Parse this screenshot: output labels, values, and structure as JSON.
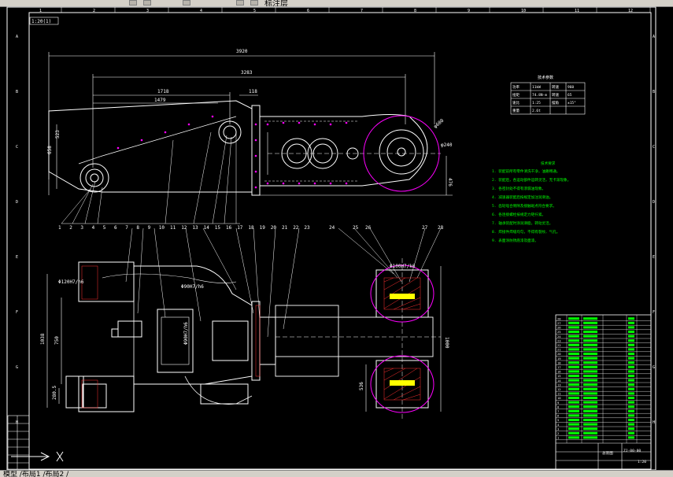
{
  "app": {
    "toolbar_text": "标注层",
    "status_text": "模型 /布局1 /布局2 /"
  },
  "drawing": {
    "frame_label": "1:20(1)",
    "col_marks": [
      "1",
      "2",
      "3",
      "4",
      "5",
      "6",
      "7",
      "8",
      "9",
      "10",
      "11",
      "12"
    ],
    "row_marks": [
      "A",
      "B",
      "C",
      "D",
      "E",
      "F",
      "G",
      "H"
    ],
    "dims": {
      "overall_length": "3920",
      "length_2": "3283",
      "length_3": "1718",
      "length_4": "1479",
      "length_5": "118",
      "height_1": "658",
      "height_2": "523",
      "height_3": "476",
      "d_ring": "φ600",
      "d_hub": "φ240",
      "fit_1": "Φ120H7/h6",
      "fit_2": "Φ90H7/h6",
      "fit_3": "Φ90H7/h6",
      "fit_4": "Φ100H7/k6",
      "plan_h1": "1038",
      "plan_h2": "750",
      "plan_h3": "1000",
      "plan_h4": "536",
      "plan_h5": "280.5"
    },
    "part_numbers_top": [
      "1",
      "2",
      "3",
      "4",
      "5",
      "6",
      "7",
      "8",
      "9",
      "10",
      "11",
      "12",
      "13",
      "14",
      "15",
      "16",
      "17",
      "18",
      "19",
      "20",
      "21",
      "22",
      "23"
    ],
    "part_numbers_right": [
      "24",
      "25",
      "26",
      "27",
      "28"
    ],
    "param_table": {
      "title": "技术参数",
      "rows": [
        [
          "功率",
          "11kW",
          "转速",
          "960"
        ],
        [
          "扭矩",
          "74.8N·m",
          "转速",
          "65"
        ],
        [
          "速比",
          "1:25",
          "摆角",
          "±15°"
        ],
        [
          "重量",
          "2.6t",
          "",
          ""
        ]
      ]
    },
    "tech_req": {
      "title": "技术要求",
      "lines": [
        "1. 装配前所有零件清洗干净，油路畅通。",
        "2. 装配后，各运动部件运转灵活，无卡滞现象。",
        "3. 各密封处不得有渗漏油现象。",
        "4. 减速器装配后按规定加注润滑油。",
        "5. 齿轮啮合侧隙及接触斑点符合要求。",
        "6. 各连接螺栓按规定力矩拧紧。",
        "7. 轴承装配时涂润滑脂，转动灵活。",
        "8. 焊接件焊缝均匀，不得有裂纹、气孔。",
        "9. 表面涂防锈底漆及面漆。"
      ]
    },
    "title_block": {
      "drawing_name": "总装图",
      "drawing_no": "ZJ-00-00",
      "scale": "1:20"
    },
    "bom_rows": [
      "28",
      "27",
      "26",
      "25",
      "24",
      "23",
      "22",
      "21",
      "20",
      "19",
      "18",
      "17",
      "16",
      "15",
      "14",
      "13",
      "12",
      "11",
      "10",
      "9",
      "8",
      "7",
      "6",
      "5",
      "4",
      "3",
      "2",
      "1"
    ]
  },
  "colors": {
    "background": "#000000",
    "frame": "#ffffff",
    "text": "#ffffff",
    "dimension": "#ffffff",
    "part_text": "#00ff00",
    "highlight": "#ff00ff",
    "yellow_seal": "#ffff00",
    "red_hatch": "#ff3030",
    "chrome_gray": "#d4d0c8"
  }
}
